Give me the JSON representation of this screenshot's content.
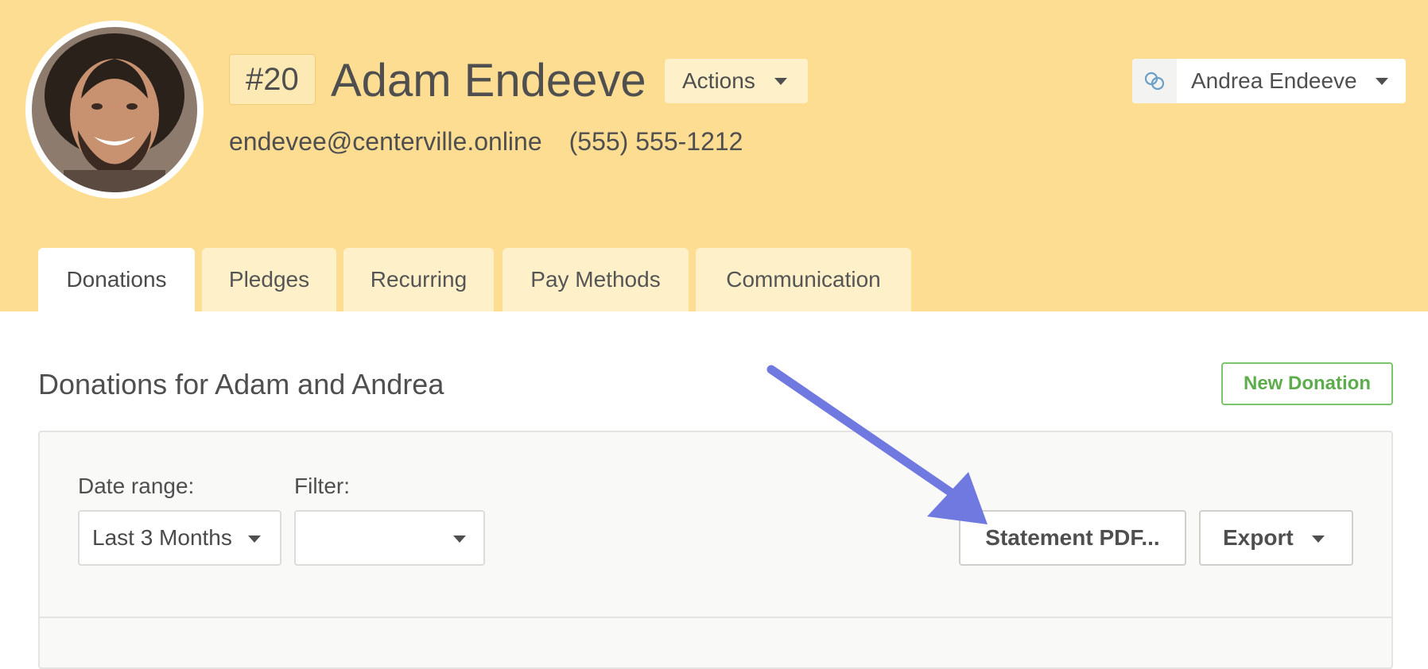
{
  "profile": {
    "id_badge": "#20",
    "name": "Adam Endeeve",
    "email": "endevee@centerville.online",
    "phone": "(555) 555-1212",
    "actions_label": "Actions"
  },
  "spouse": {
    "name": "Andrea Endeeve",
    "icon": "link-rings-icon"
  },
  "tabs": [
    {
      "label": "Donations",
      "active": true
    },
    {
      "label": "Pledges",
      "active": false
    },
    {
      "label": "Recurring",
      "active": false
    },
    {
      "label": "Pay Methods",
      "active": false
    },
    {
      "label": "Communication",
      "active": false
    }
  ],
  "section": {
    "title": "Donations for Adam and Andrea",
    "new_button": "New Donation"
  },
  "filters": {
    "date_range_label": "Date range:",
    "date_range_value": "Last 3 Months",
    "filter_label": "Filter:",
    "filter_value": ""
  },
  "toolbar": {
    "statement_label": "Statement PDF...",
    "export_label": "Export"
  },
  "colors": {
    "header_bg": "#fcdd92",
    "tab_bg": "#fef0c8",
    "accent_green": "#5dad4d",
    "annotation_arrow": "#6f79e0"
  }
}
